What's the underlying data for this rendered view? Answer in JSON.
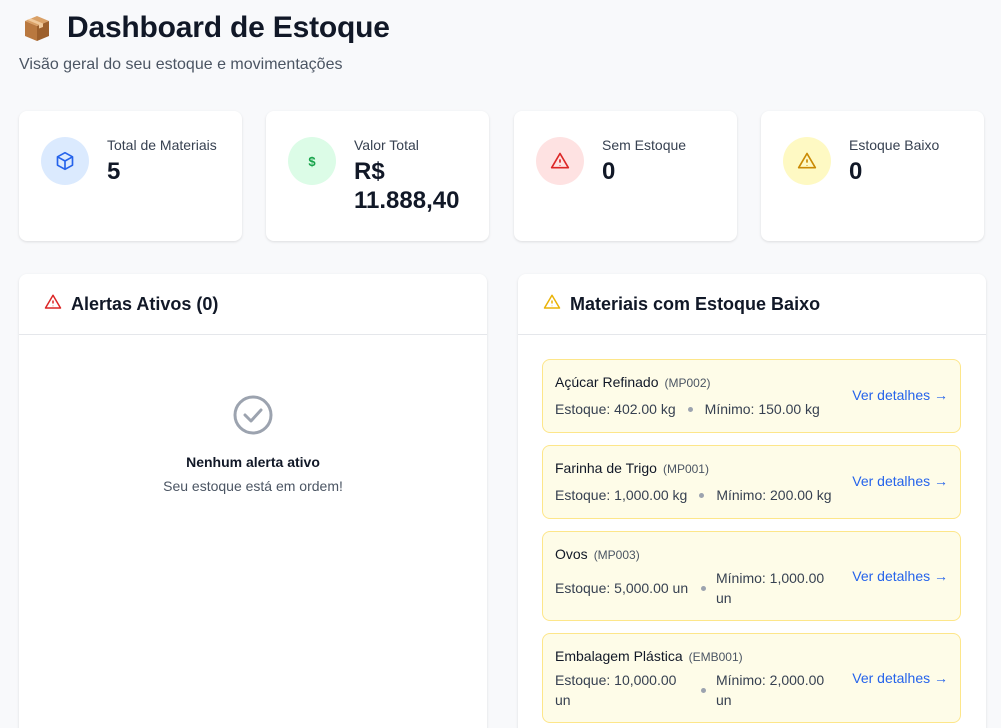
{
  "header": {
    "title": "Dashboard de Estoque",
    "subtitle": "Visão geral do seu estoque e movimentações",
    "icon": "package-icon"
  },
  "stats": [
    {
      "label": "Total de Materiais",
      "value": "5",
      "icon": "cube-icon",
      "color": "#2563eb",
      "bg": "#dbeafe"
    },
    {
      "label": "Valor Total",
      "value": "R$ 11.888,40",
      "icon": "dollar-icon",
      "color": "#16a34a",
      "bg": "#dcfce7"
    },
    {
      "label": "Sem Estoque",
      "value": "0",
      "icon": "alert-triangle-icon",
      "color": "#dc2626",
      "bg": "#fee2e2"
    },
    {
      "label": "Estoque Baixo",
      "value": "0",
      "icon": "warning-triangle-icon",
      "color": "#ca8a04",
      "bg": "#fef9c3"
    }
  ],
  "alerts": {
    "title": "Alertas Ativos (0)",
    "empty_title": "Nenhum alerta ativo",
    "empty_text": "Seu estoque está em ordem!"
  },
  "low_stock": {
    "title": "Materiais com Estoque Baixo",
    "link_label": "Ver detalhes →",
    "items": [
      {
        "name": "Açúcar Refinado",
        "code": "(MP002)",
        "stock": "Estoque: 402.00 kg",
        "min": "Mínimo: 150.00 kg"
      },
      {
        "name": "Farinha de Trigo",
        "code": "(MP001)",
        "stock": "Estoque: 1,000.00 kg",
        "min": "Mínimo: 200.00 kg"
      },
      {
        "name": "Ovos",
        "code": "(MP003)",
        "stock": "Estoque: 5,000.00 un",
        "min": "Mínimo: 1,000.00 un"
      },
      {
        "name": "Embalagem Plástica",
        "code": "(EMB001)",
        "stock": "Estoque: 10,000.00 un",
        "min": "Mínimo: 2,000.00 un"
      }
    ]
  }
}
